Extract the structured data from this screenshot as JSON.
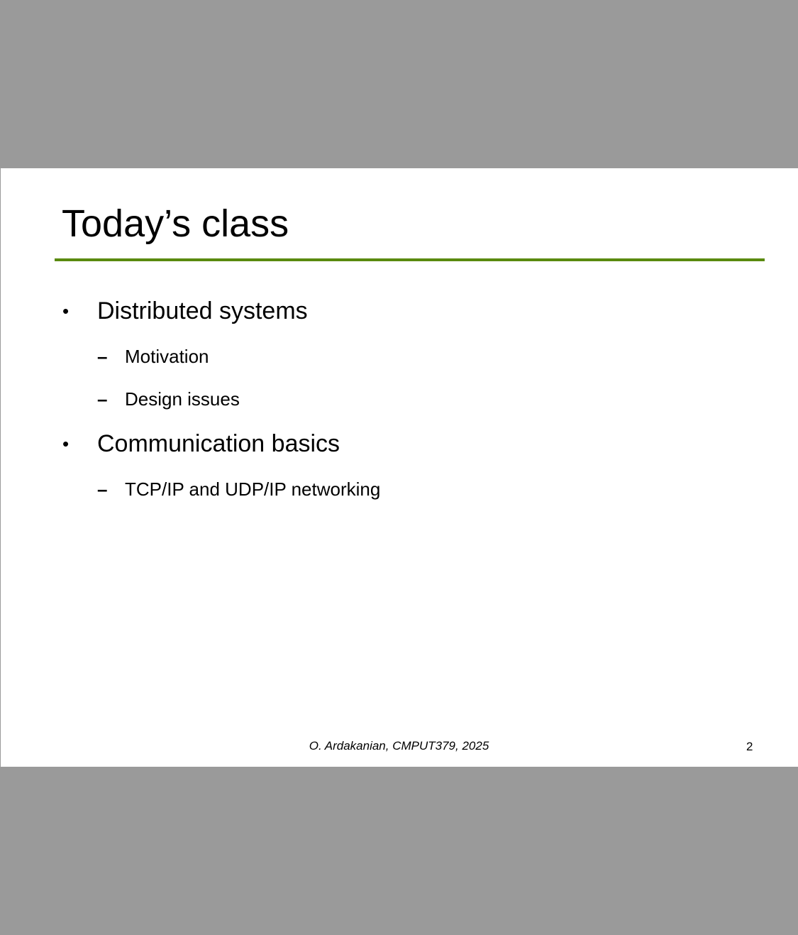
{
  "slide": {
    "title": "Today’s class",
    "accent_color": "#5a8a0f",
    "bullets": [
      {
        "marker": "•",
        "label": "Distributed systems",
        "subitems": [
          {
            "marker": "–",
            "label": "Motivation"
          },
          {
            "marker": "–",
            "label": "Design issues"
          }
        ]
      },
      {
        "marker": "•",
        "label": "Communication basics",
        "subitems": [
          {
            "marker": "–",
            "label": "TCP/IP and UDP/IP networking"
          }
        ]
      }
    ],
    "footer": "O. Ardakanian, CMPUT379, 2025",
    "page_number": "2"
  },
  "viewer": {
    "background_color": "#9a9a9a"
  }
}
